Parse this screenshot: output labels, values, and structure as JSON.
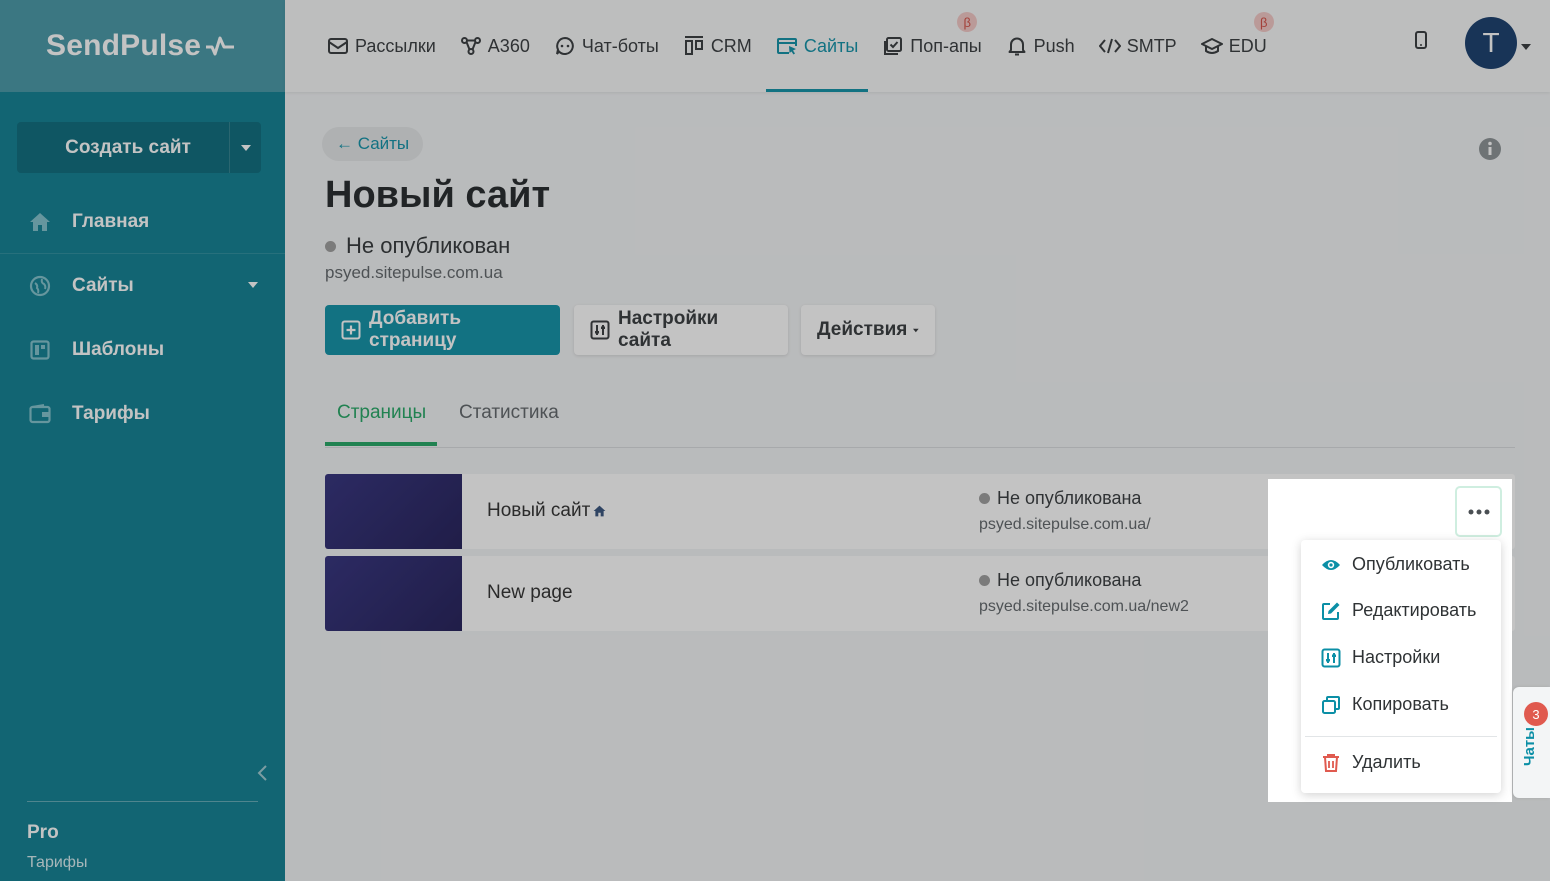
{
  "brand": {
    "logo": "SendPulse"
  },
  "sidebar": {
    "create_button": "Создать сайт",
    "items": [
      {
        "label": "Главная",
        "icon": "home-icon"
      },
      {
        "label": "Сайты",
        "icon": "globe-icon"
      },
      {
        "label": "Шаблоны",
        "icon": "templates-icon"
      },
      {
        "label": "Тарифы",
        "icon": "wallet-icon"
      }
    ],
    "plan": "Pro",
    "plan_link": "Тарифы"
  },
  "topnav": {
    "items": [
      {
        "label": "Рассылки",
        "icon": "envelope-icon"
      },
      {
        "label": "A360",
        "icon": "automation-icon"
      },
      {
        "label": "Чат-боты",
        "icon": "chat-bot-icon"
      },
      {
        "label": "CRM",
        "icon": "crm-icon"
      },
      {
        "label": "Сайты",
        "icon": "sites-icon",
        "active": true
      },
      {
        "label": "Поп-апы",
        "icon": "popup-icon",
        "beta": "β"
      },
      {
        "label": "Push",
        "icon": "bell-icon"
      },
      {
        "label": "SMTP",
        "icon": "code-icon"
      },
      {
        "label": "EDU",
        "icon": "graduation-cap-icon",
        "beta": "β"
      }
    ],
    "avatar_letter": "T"
  },
  "page": {
    "back_label": "← Сайты",
    "title": "Новый сайт",
    "status": "Не опубликован",
    "url": "psyed.sitepulse.com.ua",
    "buttons": {
      "add_page": "Добавить страницу",
      "settings": "Настройки сайта",
      "actions": "Действия"
    },
    "tabs": [
      "Страницы",
      "Статистика"
    ]
  },
  "pages": [
    {
      "name": "Новый сайт",
      "status": "Не опубликована",
      "url": "psyed.sitepulse.com.ua/",
      "home": true
    },
    {
      "name": "New page",
      "status": "Не опубликована",
      "url": "psyed.sitepulse.com.ua/new2",
      "home": false
    }
  ],
  "menu": {
    "items": [
      {
        "label": "Опубликовать",
        "icon": "eye-icon"
      },
      {
        "label": "Редактировать",
        "icon": "edit-icon"
      },
      {
        "label": "Настройки",
        "icon": "sliders-icon"
      },
      {
        "label": "Копировать",
        "icon": "copy-icon"
      },
      {
        "label": "Удалить",
        "icon": "trash-icon"
      }
    ]
  },
  "chats": {
    "label": "Чаты",
    "count": "3"
  },
  "colors": {
    "primary": "#0b8fa6",
    "sidebar": "#0a7d90",
    "danger": "#e05a4f",
    "active_tab": "#1fa562"
  }
}
